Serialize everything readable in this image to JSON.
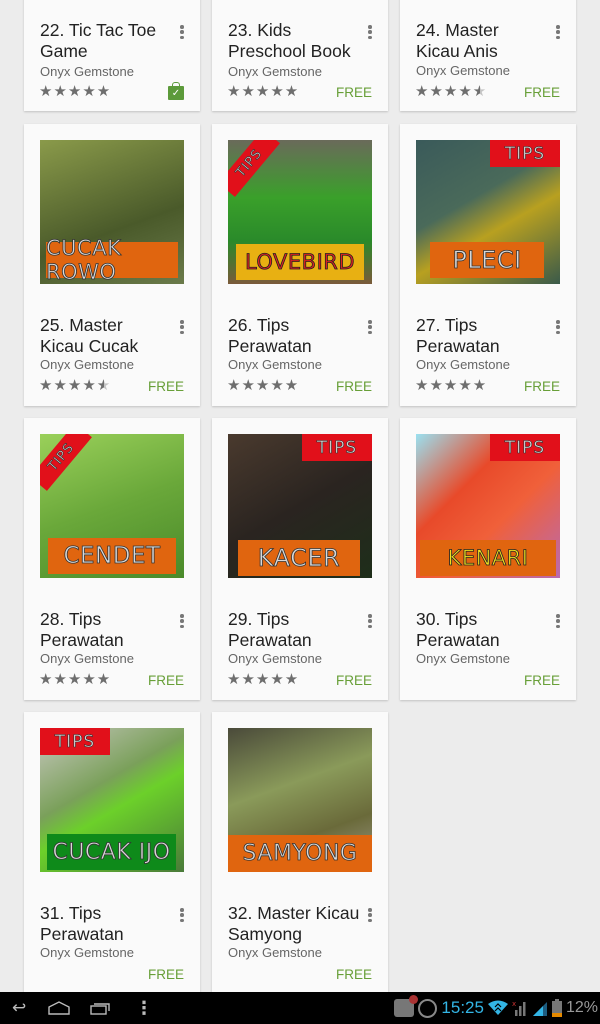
{
  "apps": [
    {
      "title": "22. Tic Tac Toe Game",
      "developer": "Onyx Gemstone",
      "rating": 5,
      "price": "",
      "installed": true,
      "thumb": null
    },
    {
      "title": "23. Kids Preschool Book",
      "developer": "Onyx Gemstone",
      "rating": 5,
      "price": "FREE",
      "installed": false,
      "thumb": null
    },
    {
      "title": "24. Master Kicau Anis",
      "developer": "Onyx Gemstone",
      "rating": 4.5,
      "price": "FREE",
      "installed": false,
      "thumb": null
    },
    {
      "title": "25. Master Kicau Cucak",
      "developer": "Onyx Gemstone",
      "rating": 4.5,
      "price": "FREE",
      "thumb": {
        "label": "CUCAK ROWO",
        "tips": "",
        "bg": [
          "#6b7a3a",
          "#3e4d24"
        ],
        "banner_color": "#e0650f"
      }
    },
    {
      "title": "26. Tips Perawatan",
      "developer": "Onyx Gemstone",
      "rating": 5,
      "price": "FREE",
      "thumb": {
        "label": "LOVEBIRD",
        "tips": "TIPS",
        "bg": [
          "#6a7d5a",
          "#3aa02a"
        ],
        "banner_color": "#e8b012"
      }
    },
    {
      "title": "27. Tips Perawatan",
      "developer": "Onyx Gemstone",
      "rating": 5,
      "price": "FREE",
      "thumb": {
        "label": "PLECI",
        "tips": "TIPS",
        "bg": [
          "#4a6a5a",
          "#b09a2a"
        ],
        "banner_color": "#e0650f"
      }
    },
    {
      "title": "28. Tips Perawatan",
      "developer": "Onyx Gemstone",
      "rating": 5,
      "price": "FREE",
      "thumb": {
        "label": "CENDET",
        "tips": "TIPS",
        "bg": [
          "#8cc04a",
          "#4f8a2a"
        ],
        "banner_color": "#e0650f"
      }
    },
    {
      "title": "29. Tips Perawatan",
      "developer": "Onyx Gemstone",
      "rating": 5,
      "price": "FREE",
      "thumb": {
        "label": "KACER",
        "tips": "TIPS",
        "bg": [
          "#3a2e26",
          "#1e2a1a"
        ],
        "banner_color": "#e0650f"
      }
    },
    {
      "title": "30. Tips Perawatan",
      "developer": "Onyx Gemstone",
      "rating": null,
      "price": "FREE",
      "thumb": {
        "label": "KENARI",
        "tips": "TIPS",
        "bg": [
          "#8ad8e8",
          "#e84a2a"
        ],
        "banner_color": "#e0650f"
      }
    },
    {
      "title": "31. Tips Perawatan",
      "developer": "Onyx Gemstone",
      "rating": null,
      "price": "FREE",
      "thumb": {
        "label": "CUCAK IJO",
        "tips": "TIPS",
        "bg": [
          "#8aa070",
          "#5cc02a"
        ],
        "banner_color": "#0e8a1a"
      }
    },
    {
      "title": "32. Master Kicau Samyong",
      "developer": "Onyx Gemstone",
      "rating": null,
      "price": "FREE",
      "thumb": {
        "label": "SAMYONG",
        "tips": "",
        "bg": [
          "#5a5a3a",
          "#8a8a6a"
        ],
        "banner_color": "#e0650f"
      }
    }
  ],
  "navbar": {
    "back_icon": "↩",
    "home_icon": "⌂",
    "recents_icon": "▭",
    "menu_icon": "⋮",
    "time": "15:25",
    "battery": "12%"
  }
}
